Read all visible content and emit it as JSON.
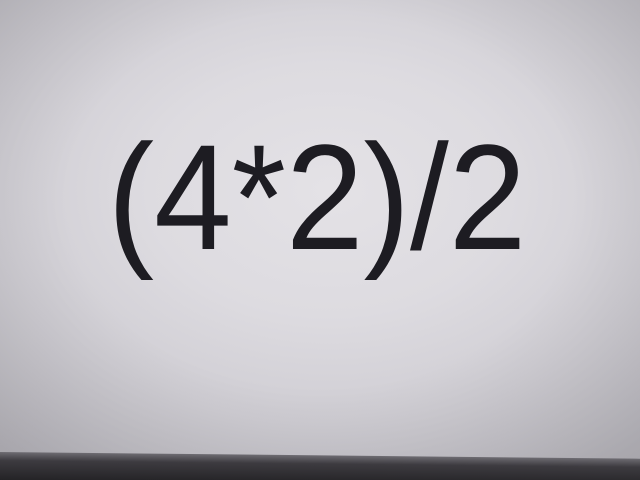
{
  "expression": "(4*2)/2",
  "colors": {
    "text": "#1d1c22",
    "screen": "#dddbe0",
    "bezel": "#242326"
  }
}
